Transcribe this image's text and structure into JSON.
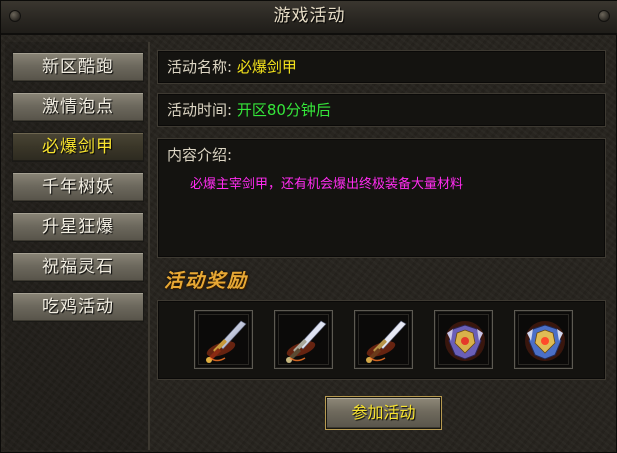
{
  "window": {
    "title": "游戏活动"
  },
  "sidebar": {
    "items": [
      {
        "label": "新区酷跑",
        "active": false
      },
      {
        "label": "激情泡点",
        "active": false
      },
      {
        "label": "必爆剑甲",
        "active": true
      },
      {
        "label": "千年树妖",
        "active": false
      },
      {
        "label": "升星狂爆",
        "active": false
      },
      {
        "label": "祝福灵石",
        "active": false
      },
      {
        "label": "吃鸡活动",
        "active": false
      }
    ]
  },
  "detail": {
    "name_label": "活动名称:",
    "name_value": "必爆剑甲",
    "time_label": "活动时间:",
    "time_value": "开区80分钟后",
    "intro_label": "内容介绍:",
    "intro_text": "必爆主宰剑甲，还有机会爆出终极装备大量材料"
  },
  "rewards": {
    "heading": "活动奖励",
    "items": [
      {
        "icon": "sword-icon"
      },
      {
        "icon": "sword-icon"
      },
      {
        "icon": "sword-icon"
      },
      {
        "icon": "armor-icon"
      },
      {
        "icon": "armor-icon"
      }
    ]
  },
  "join_button": "参加活动",
  "colors": {
    "active_text": "#f7e32f",
    "time_green": "#35e63a",
    "intro_magenta": "#ff2cf0",
    "reward_heading_gold": "#e8a935"
  }
}
